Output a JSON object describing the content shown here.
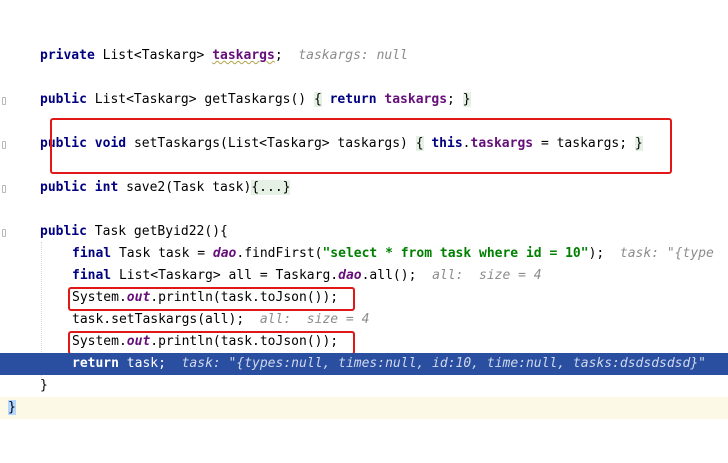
{
  "lines": {
    "field_decl": {
      "private": "private",
      "type": "List<Taskarg>",
      "name": "taskargs",
      "semi": ";",
      "hint": "taskargs: null"
    },
    "getter": {
      "public": "public",
      "type": "List<Taskarg>",
      "sig": "getTaskargs()",
      "ob": "{",
      "ret": "return",
      "field": "taskargs",
      "semi": ";",
      "cb": "}"
    },
    "setter": {
      "public": "public",
      "void": "void",
      "sig": "setTaskargs(List<Taskarg> taskargs)",
      "ob": "{",
      "this": "this",
      "dot": ".",
      "field": "taskargs",
      "rest": " = taskargs;",
      "cb": "}"
    },
    "save2": {
      "public": "public",
      "int": "int",
      "sig": "save2(Task task)",
      "fold": "{...}"
    },
    "getbyid": {
      "public": "public",
      "sig": "Task getByid22(){"
    },
    "final_task": {
      "final": "final",
      "pre": "Task task = ",
      "dao": "dao",
      "mid": ".findFirst(",
      "str": "\"select * from task where id = 10\"",
      "end": ");",
      "hint": "task: \"{type"
    },
    "final_all": {
      "final": "final",
      "pre": "List<Taskarg> all = Taskarg.",
      "dao": "dao",
      "end": ".all();",
      "hint": "all:  size = 4"
    },
    "print1": {
      "pre": "System.",
      "out": "out",
      "end": ".println(task.toJson());"
    },
    "set_call": {
      "code": "task.setTaskargs(all);",
      "hint": "all:  size = 4"
    },
    "print2": {
      "pre": "System.",
      "out": "out",
      "end": ".println(task.toJson());"
    },
    "return_line": {
      "ret": "return",
      "code": " task;",
      "hint": "task: \"{types:null, times:null, id:10, time:null, tasks:dsdsdsdsd}\""
    },
    "close_method": {
      "cb": "}"
    },
    "close_class": {
      "cb": "}"
    }
  },
  "colors": {
    "keyword": "#000080",
    "field": "#660e7a",
    "string": "#008000",
    "hint": "#8c8c8c",
    "selection": "#2a4ea0",
    "highlight_box": "#e01818"
  }
}
